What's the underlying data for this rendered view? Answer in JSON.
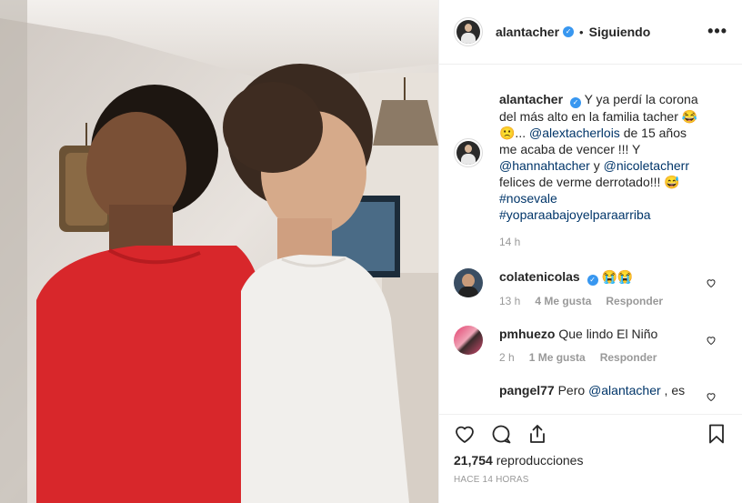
{
  "header": {
    "username": "alantacher",
    "separator": "•",
    "follow_label": "Siguiendo",
    "more_label": "•••"
  },
  "caption": {
    "username": "alantacher",
    "text_1": "Y ya perdí la corona del más alto en la familia tacher 😂🙁...",
    "mention_1": "@alextacherlois",
    "text_2": " de 15 años me acaba de vencer !!! Y ",
    "mention_2": "@hannahtacher",
    "text_3": " y ",
    "mention_3": "@nicoletacherr",
    "text_4": " felices de verme derrotado!!! 😅 ",
    "hashtag_1": "#nosevale",
    "hashtag_2": "#yoparaabajoyelparaarriba",
    "time": "14 h"
  },
  "comments": [
    {
      "username": "colatenicolas",
      "text": "😭😭",
      "time": "13 h",
      "likes": "4 Me gusta",
      "reply": "Responder"
    },
    {
      "username": "pmhuezo",
      "text": "Que lindo El Niño",
      "time": "2 h",
      "likes": "1 Me gusta",
      "reply": "Responder"
    },
    {
      "username": "pangel77",
      "text_1": "Pero ",
      "mention": "@alantacher",
      "text_2": " , es"
    }
  ],
  "footer": {
    "views_count": "21,754",
    "views_label": "reproducciones",
    "ago": "HACE 14 HORAS"
  },
  "icons": {
    "like": "heart-icon",
    "comment": "comment-icon",
    "share": "share-icon",
    "save": "bookmark-icon",
    "verified": "verified-badge-icon"
  },
  "colors": {
    "link": "#003569",
    "verified": "#3897f0",
    "muted": "#999999",
    "border": "#efefef"
  }
}
